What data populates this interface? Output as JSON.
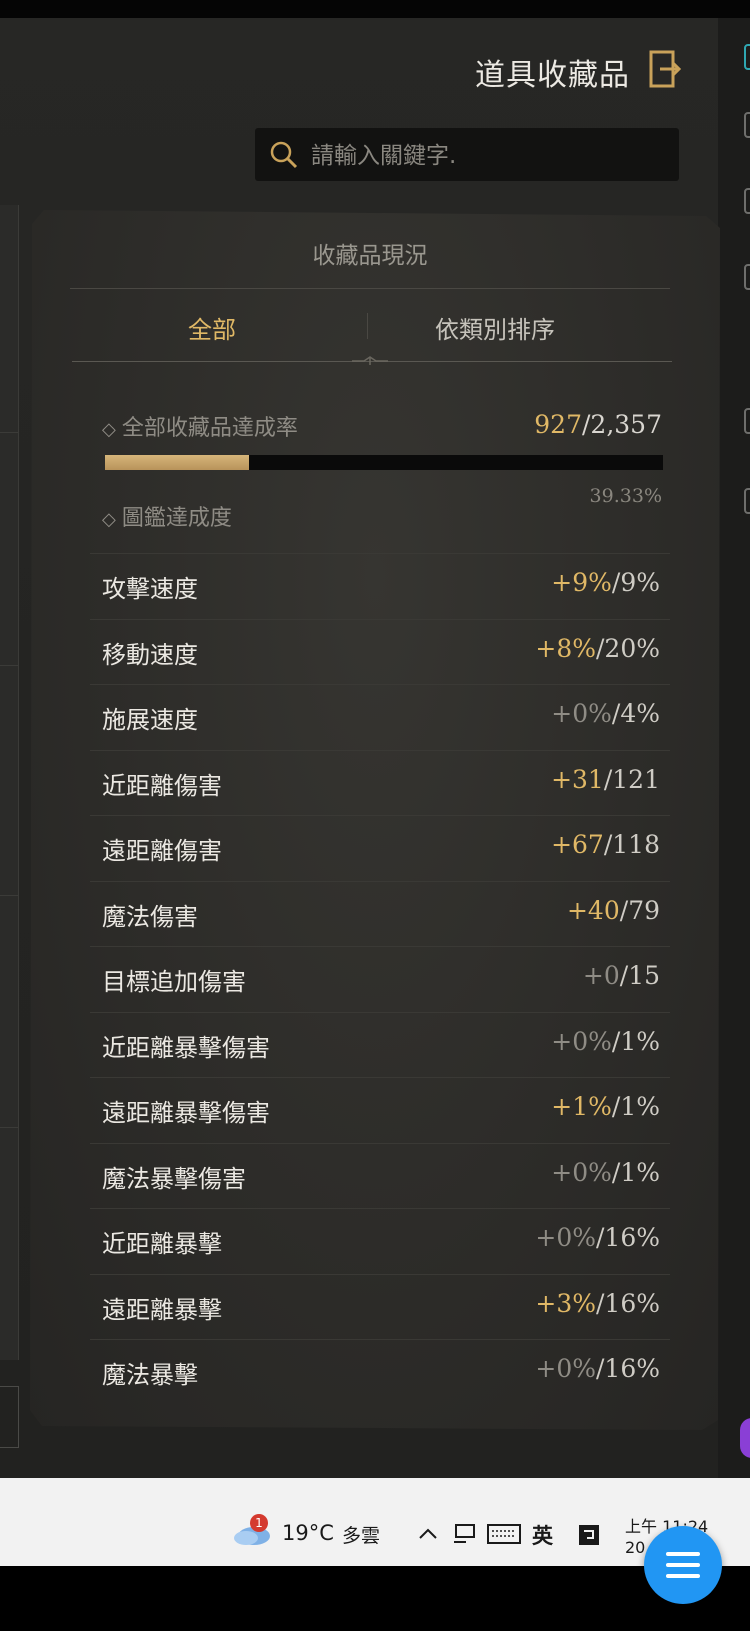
{
  "window": {
    "title": "道具收藏品",
    "exit_icon": "exit-door-icon"
  },
  "search": {
    "placeholder": "請輸入關鍵字.",
    "icon": "search-icon"
  },
  "panel": {
    "header": "收藏品現況",
    "tabs": [
      {
        "label": "全部",
        "active": true
      },
      {
        "label": "依類別排序",
        "active": false
      }
    ],
    "total": {
      "label": "全部收藏品達成率",
      "current": "927",
      "separator": "/",
      "max": "2,357",
      "percent_text": "39.33%",
      "progress": 0.3933
    },
    "codex_label": "圖鑑達成度",
    "stats": [
      {
        "label": "攻擊速度",
        "bonus": "+9%",
        "cap": "9%",
        "highlight": true
      },
      {
        "label": "移動速度",
        "bonus": "+8%",
        "cap": "20%",
        "highlight": true
      },
      {
        "label": "施展速度",
        "bonus": "+0%",
        "cap": "4%",
        "highlight": false
      },
      {
        "label": "近距離傷害",
        "bonus": "+31",
        "cap": "121",
        "highlight": true
      },
      {
        "label": "遠距離傷害",
        "bonus": "+67",
        "cap": "118",
        "highlight": true
      },
      {
        "label": "魔法傷害",
        "bonus": "+40",
        "cap": "79",
        "highlight": true
      },
      {
        "label": "目標追加傷害",
        "bonus": "+0",
        "cap": "15",
        "highlight": false
      },
      {
        "label": "近距離暴擊傷害",
        "bonus": "+0%",
        "cap": "1%",
        "highlight": false
      },
      {
        "label": "遠距離暴擊傷害",
        "bonus": "+1%",
        "cap": "1%",
        "highlight": true
      },
      {
        "label": "魔法暴擊傷害",
        "bonus": "+0%",
        "cap": "1%",
        "highlight": false
      },
      {
        "label": "近距離暴擊",
        "bonus": "+0%",
        "cap": "16%",
        "highlight": false
      },
      {
        "label": "遠距離暴擊",
        "bonus": "+3%",
        "cap": "16%",
        "highlight": true
      },
      {
        "label": "魔法暴擊",
        "bonus": "+0%",
        "cap": "16%",
        "highlight": false
      }
    ]
  },
  "taskbar": {
    "weather_badge": "1",
    "temperature": "19°C",
    "weather": "多雲",
    "ime": "英",
    "time": "上午 11:24",
    "date_partial": "20"
  },
  "colors": {
    "gold": "#e0b866",
    "fab_blue": "#2196f3"
  }
}
